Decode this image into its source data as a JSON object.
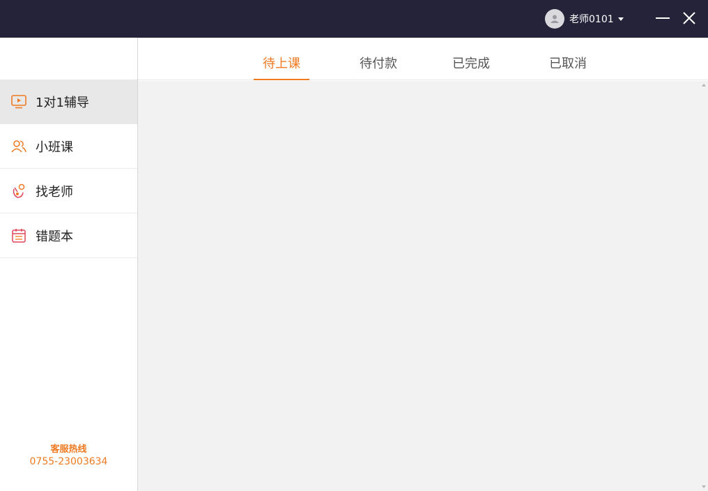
{
  "titlebar": {
    "username": "老师0101",
    "icons": {
      "avatar": "user-avatar-icon",
      "dropdown": "caret-down-icon",
      "minimize": "minimize-icon",
      "close": "close-icon"
    }
  },
  "sidebar": {
    "items": [
      {
        "label": "1对1辅导",
        "icon": "play-screen-icon",
        "active": true
      },
      {
        "label": "小班课",
        "icon": "group-icon",
        "active": false
      },
      {
        "label": "找老师",
        "icon": "search-teacher-icon",
        "active": false
      },
      {
        "label": "错题本",
        "icon": "calendar-notebook-icon",
        "active": false
      }
    ],
    "hotline": {
      "title": "客服热线",
      "phone": "0755-23003634"
    }
  },
  "tabs": [
    {
      "label": "待上课",
      "active": true
    },
    {
      "label": "待付款",
      "active": false
    },
    {
      "label": "已完成",
      "active": false
    },
    {
      "label": "已取消",
      "active": false
    }
  ],
  "colors": {
    "accent": "#ef7a22",
    "titlebar": "#24233a",
    "content_bg": "#f2f2f2",
    "icon_red": "#e0455a"
  }
}
